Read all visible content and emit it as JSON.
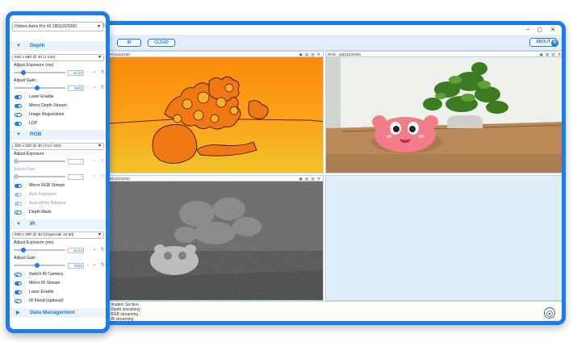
{
  "window": {
    "tabs": [
      {
        "label": "IR"
      },
      {
        "label": "CLOUD"
      }
    ],
    "about_label": "ABOUT",
    "controls": {
      "minimize": "–",
      "maximize": "▢",
      "close": "✕"
    },
    "streams": {
      "depth": {
        "title": "0011020260"
      },
      "rgb": {
        "title": "RGB - 18011020260"
      },
      "ir": {
        "title": "0011020260"
      }
    },
    "log": {
      "lines": [
        "rmation Section",
        "Depth streaming",
        "RGB streaming",
        "IR streaming"
      ]
    },
    "logo_caption": "ORBBEC"
  },
  "panel": {
    "device": "Orbbec Astra Pro #0 18011020260",
    "sections": {
      "depth": {
        "title": "Depth",
        "mode": "640 x 480 @ 30 (1 mm)",
        "exposure_label": "Adjust Exposure (ms)",
        "exposure_value": "33.34",
        "exposure_level": 0.15,
        "gain_label": "Adjust Gain",
        "gain_value": "8000",
        "gain_level": 0.45,
        "toggles": [
          {
            "label": "Laser Enable",
            "on": true
          },
          {
            "label": "Mirror Depth Stream",
            "on": true
          },
          {
            "label": "Image Registration",
            "on": false
          },
          {
            "label": "LDP",
            "on": true
          }
        ]
      },
      "rgb": {
        "title": "RGB",
        "mode": "320 x 240 @ 30 (YUV 422)",
        "exposure_label": "Adjust Exposure",
        "exposure_value": "0",
        "gain_label": "Adjust Gain",
        "gain_value": "0",
        "toggles": [
          {
            "label": "Mirror RGB Stream",
            "on": true
          },
          {
            "label": "Auto Exposure",
            "on": true
          },
          {
            "label": "Auto White Balance",
            "on": true
          },
          {
            "label": "Depth Mask",
            "on": false
          }
        ]
      },
      "ir": {
        "title": "IR",
        "mode": "640 x 480 @ 30 (Grayscale 16-bit)",
        "exposure_label": "Adjust Exposure (ms)",
        "exposure_value": "33.34",
        "exposure_level": 0.15,
        "gain_label": "Adjust Gain",
        "gain_value": "8000",
        "gain_level": 0.45,
        "toggles": [
          {
            "label": "Switch IR Camera",
            "on": false
          },
          {
            "label": "Mirror IR Stream",
            "on": true
          },
          {
            "label": "Laser Enable",
            "on": true
          },
          {
            "label": "IR Flood (optional)",
            "on": false
          }
        ]
      },
      "data_management": {
        "title": "Data Management"
      }
    }
  },
  "colors": {
    "accent": "#1b7cf0",
    "depth_bg": "#f59a12",
    "stream_bg": "#dfeefb"
  }
}
